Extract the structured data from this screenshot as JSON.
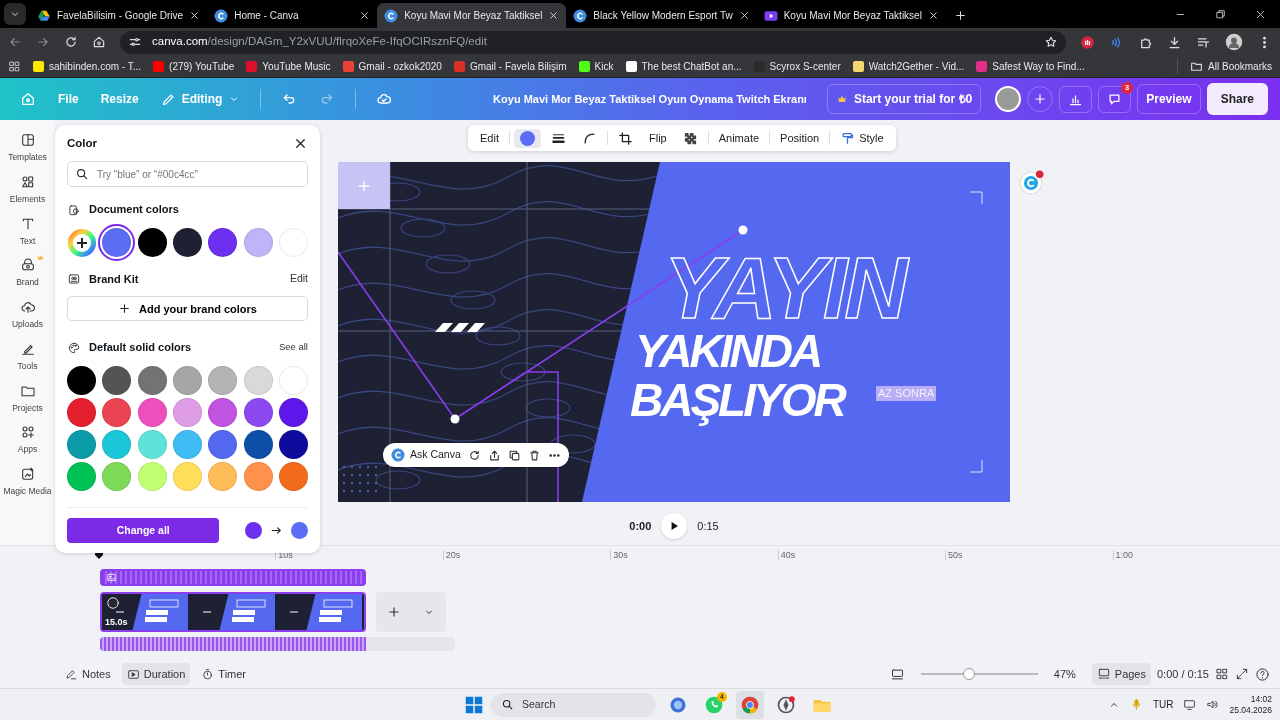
{
  "browser": {
    "tabs": [
      {
        "title": "FavelaBilisim - Google Drive",
        "kind": "drive",
        "selected": false
      },
      {
        "title": "Home - Canva",
        "kind": "canva",
        "selected": false
      },
      {
        "title": "Koyu Mavi Mor Beyaz Taktiksel",
        "kind": "canva",
        "selected": true
      },
      {
        "title": "Black Yellow Modern Esport Tw",
        "kind": "canva",
        "selected": false
      },
      {
        "title": "Koyu Mavi Mor Beyaz Taktiksel",
        "kind": "video",
        "selected": false
      }
    ],
    "url_host": "canva.com",
    "url_path": "/design/DAGm_Y2xVUU/flrqoXeFe-IfqOCIRsznFQ/edit",
    "bookmarks": [
      {
        "label": "sahibinden.com - T...",
        "color": "#ffe800"
      },
      {
        "label": "(279) YouTube",
        "color": "#ff0000"
      },
      {
        "label": "YouTube Music",
        "color": "#e0102a"
      },
      {
        "label": "Gmail - ozkok2020",
        "color": "#ea4335"
      },
      {
        "label": "Gmail - Favela Bilişim",
        "color": "#d93025"
      },
      {
        "label": "Kick",
        "color": "#53fc18"
      },
      {
        "label": "The best ChatBot an...",
        "color": "#ffffff"
      },
      {
        "label": "Scyrox S-center",
        "color": "#2b2b2b"
      },
      {
        "label": "Watch2Gether - Vid...",
        "color": "#f5d76e"
      },
      {
        "label": "Safest Way to Find...",
        "color": "#e0308a"
      }
    ],
    "all_bookmarks": "All Bookmarks"
  },
  "header": {
    "menu": [
      "File",
      "Resize"
    ],
    "mode": "Editing",
    "history": [
      {
        "kind": "undo",
        "disabled": false
      },
      {
        "kind": "redo",
        "disabled": true
      }
    ],
    "title": "Koyu Mavi Mor Beyaz Taktiksel Oyun Oynama Twitch Ekranı",
    "trial": "Start your trial for ₺0",
    "comments_badge": "3",
    "preview": "Preview",
    "share": "Share"
  },
  "sidebar": {
    "items": [
      {
        "label": "Templates",
        "kind": "templates",
        "premium": false
      },
      {
        "label": "Elements",
        "kind": "elements",
        "premium": false
      },
      {
        "label": "Text",
        "kind": "text",
        "premium": false
      },
      {
        "label": "Brand",
        "kind": "brand",
        "premium": true
      },
      {
        "label": "Uploads",
        "kind": "uploads",
        "premium": false
      },
      {
        "label": "Tools",
        "kind": "tools",
        "premium": false
      },
      {
        "label": "Projects",
        "kind": "projects",
        "premium": false
      },
      {
        "label": "Apps",
        "kind": "apps",
        "premium": false
      },
      {
        "label": "Magic Media",
        "kind": "magic",
        "premium": false
      }
    ]
  },
  "color_panel": {
    "title": "Color",
    "search": {
      "placeholder": "Try “blue” or “#00c4cc”"
    },
    "document_heading": "Document colors",
    "document_colors": [
      {
        "color": "#5b6cf5",
        "selected": true
      },
      {
        "color": "#000000",
        "selected": false
      },
      {
        "color": "#1d2133",
        "selected": false
      },
      {
        "color": "#6d2ff0",
        "selected": false
      },
      {
        "color": "#bdb5f7",
        "selected": false
      },
      {
        "color": "#ffffff",
        "selected": false
      }
    ],
    "brand_heading": "Brand Kit",
    "brand_edit": "Edit",
    "add_brand": "Add your brand colors",
    "default_heading": "Default solid colors",
    "see_all": "See all",
    "default_colors": [
      {
        "color": "#000000"
      },
      {
        "color": "#545454"
      },
      {
        "color": "#737373"
      },
      {
        "color": "#a6a6a6"
      },
      {
        "color": "#b4b4b4"
      },
      {
        "color": "#d9d9d9"
      },
      {
        "color": "#ffffff"
      },
      {
        "color": "#e4202e"
      },
      {
        "color": "#ea4452"
      },
      {
        "color": "#ee4fbd"
      },
      {
        "color": "#df9de8"
      },
      {
        "color": "#c054e0"
      },
      {
        "color": "#8c49f0"
      },
      {
        "color": "#5e17eb"
      },
      {
        "color": "#0c9ba8"
      },
      {
        "color": "#1bc6d8"
      },
      {
        "color": "#5de3d8"
      },
      {
        "color": "#3fbcf3"
      },
      {
        "color": "#5468f0"
      },
      {
        "color": "#0d4ea6"
      },
      {
        "color": "#0f0b9c"
      },
      {
        "color": "#00c154"
      },
      {
        "color": "#7ed957"
      },
      {
        "color": "#c1ff72"
      },
      {
        "color": "#ffde59"
      },
      {
        "color": "#ffbd59"
      },
      {
        "color": "#ff914d"
      },
      {
        "color": "#f26a1b"
      }
    ],
    "change_all": "Change all"
  },
  "element_toolbar": {
    "edit": "Edit",
    "flip": "Flip",
    "animate": "Animate",
    "position": "Position",
    "style": "Style"
  },
  "canvas": {
    "outline_title": "YAYIN",
    "title_line_1": "YAKINDA",
    "title_line_2": "BAŞLIYOR",
    "tag": "AZ SONRA",
    "ask": "Ask Canva"
  },
  "playback": {
    "current": "0:00",
    "total": "0:15"
  },
  "timeline": {
    "ticks": [
      "10s",
      "20s",
      "30s",
      "40s",
      "50s",
      "1:00"
    ],
    "clip_duration": "15.0s"
  },
  "footer": {
    "left": [
      {
        "label": "Notes",
        "kind": "notes",
        "selected": false
      },
      {
        "label": "Duration",
        "kind": "duration",
        "selected": true
      },
      {
        "label": "Timer",
        "kind": "timer",
        "selected": false
      }
    ],
    "zoom": {
      "level": 0.41,
      "reading": "47%"
    },
    "pages": {
      "label": "Pages",
      "selected": true
    },
    "time": "0:00 / 0:15"
  },
  "taskbar": {
    "search": "Search",
    "apps": [
      {
        "kind": "copilot",
        "selected": false
      },
      {
        "kind": "whatsapp",
        "badge": "4",
        "selected": false
      },
      {
        "kind": "chrome",
        "selected": true
      },
      {
        "kind": "app",
        "selected": false
      },
      {
        "kind": "folder",
        "selected": false
      }
    ],
    "language": "TUR",
    "time": "14:02",
    "date": "25.04.2026"
  }
}
